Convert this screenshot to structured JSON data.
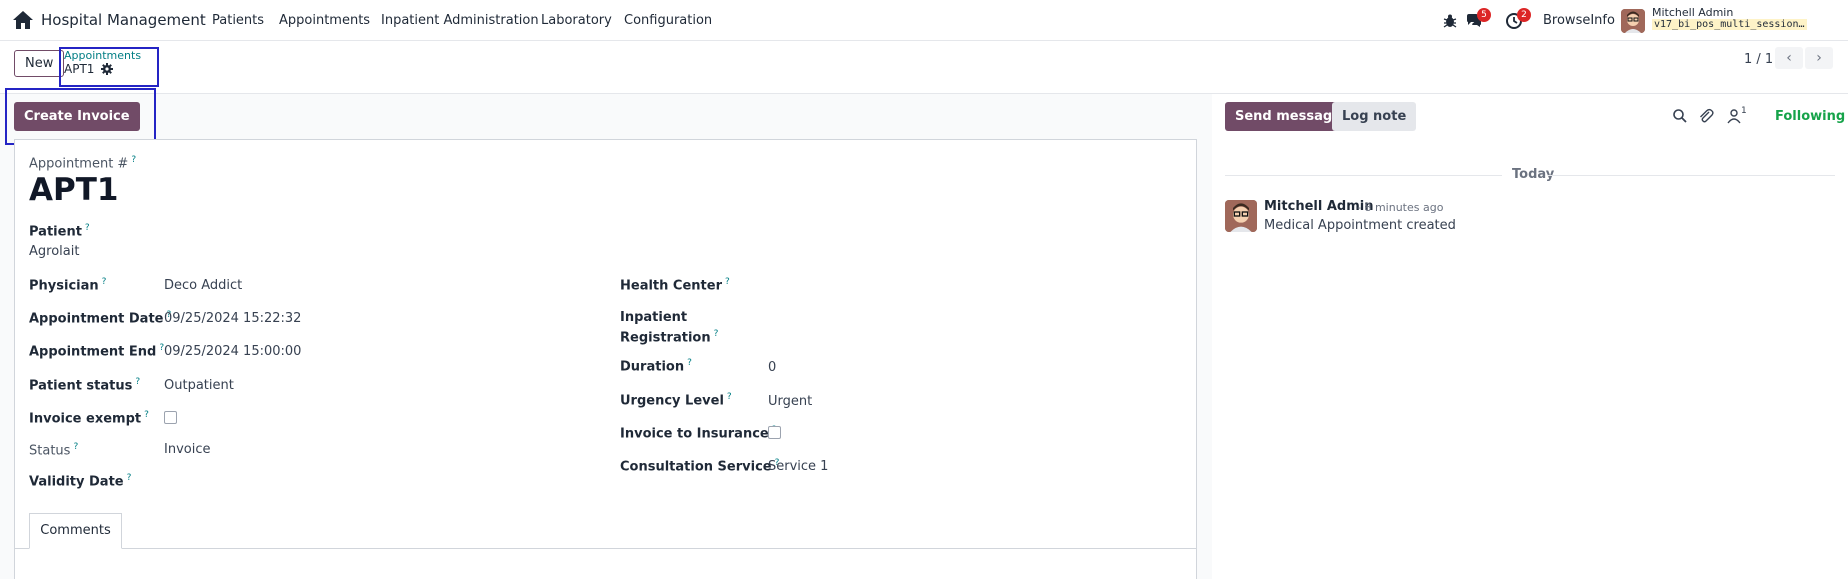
{
  "nav": {
    "app_title": "Hospital Management",
    "menus": [
      "Patients",
      "Appointments",
      "Inpatient Administration",
      "Laboratory",
      "Configuration"
    ],
    "messages_badge": "5",
    "activities_badge": "2",
    "company": "BrowseInfo",
    "user_name": "Mitchell Admin",
    "database": "v17_bi_pos_multi_session…"
  },
  "control": {
    "new_label": "New",
    "breadcrumb_parent": "Appointments",
    "breadcrumb_current": "APT1",
    "pager": "1 / 1"
  },
  "actions": {
    "create_invoice": "Create Invoice",
    "send_message": "Send message",
    "log_note": "Log note",
    "followers_count": "1",
    "following": "Following"
  },
  "form": {
    "appointment_label": "Appointment #",
    "appointment_number": "APT1",
    "patient_label": "Patient",
    "patient_value": "Agrolait",
    "physician_label": "Physician",
    "physician_value": "Deco Addict",
    "appointment_date_label": "Appointment Date",
    "appointment_date_value": "09/25/2024 15:22:32",
    "appointment_end_label": "Appointment End",
    "appointment_end_value": "09/25/2024 15:00:00",
    "patient_status_label": "Patient status",
    "patient_status_value": "Outpatient",
    "invoice_exempt_label": "Invoice exempt",
    "invoice_exempt_checked": false,
    "status_label": "Status",
    "status_value": "Invoice",
    "validity_date_label": "Validity Date",
    "validity_date_value": "",
    "health_center_label": "Health Center",
    "health_center_value": "",
    "inpatient_registration_label_1": "Inpatient",
    "inpatient_registration_label_2": "Registration",
    "duration_label": "Duration",
    "duration_value": "0",
    "urgency_label": "Urgency Level",
    "urgency_value": "Urgent",
    "invoice_insurance_label": "Invoice to Insurance",
    "invoice_insurance_checked": false,
    "consultation_service_label": "Consultation Service",
    "consultation_service_value": "Service 1",
    "tab_comments": "Comments"
  },
  "chatter": {
    "today": "Today",
    "author": "Mitchell Admin",
    "time": "- 8 minutes ago",
    "body": "Medical Appointment created"
  },
  "colors": {
    "primary": "#714b67",
    "link": "#017e84",
    "following": "#16a34a",
    "badge": "#dc2626",
    "highlight_box": "#2424c4"
  },
  "icons": [
    "home-icon",
    "bug-icon",
    "messages-icon",
    "activities-icon",
    "gear-icon",
    "chevron-left-icon",
    "chevron-right-icon",
    "search-icon",
    "paperclip-icon",
    "followers-icon"
  ]
}
